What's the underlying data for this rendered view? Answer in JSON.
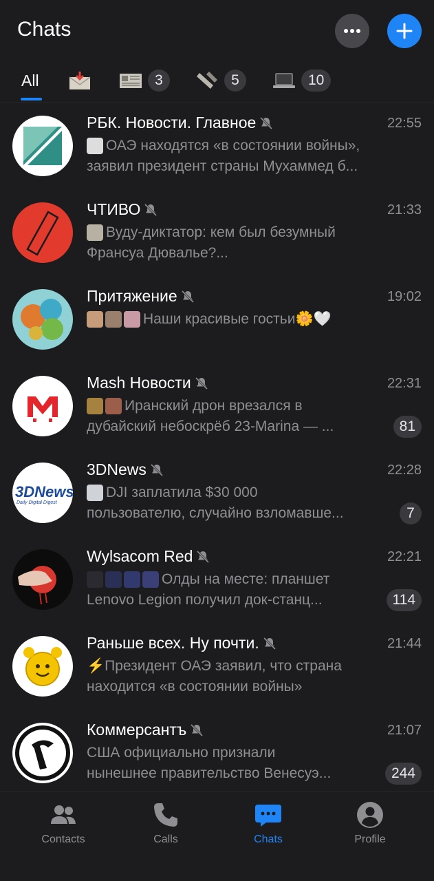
{
  "header": {
    "title": "Chats",
    "more_icon": "ellipsis-icon",
    "new_icon": "plus-icon"
  },
  "folders": [
    {
      "label": "All",
      "active": true
    },
    {
      "icon": "inbox-icon",
      "count": ""
    },
    {
      "icon": "newspaper-icon",
      "count": "3"
    },
    {
      "icon": "scroll-icon",
      "count": "5"
    },
    {
      "icon": "laptop-icon",
      "count": "10"
    }
  ],
  "chats": [
    {
      "name": "РБК. Новости. Главное",
      "time": "22:55",
      "line1": "ОАЭ находятся «в состоянии войны»,",
      "line2": "заявил президент страны Мухаммед б...",
      "unread": ""
    },
    {
      "name": "ЧТИВО",
      "time": "21:33",
      "line1": "Вуду-диктатор: кем был безумный",
      "line2": "Франсуа Дювалье?...",
      "unread": ""
    },
    {
      "name": "Притяжение",
      "time": "19:02",
      "line1": "Наши красивые гостьи🌼🤍",
      "line2": "",
      "unread": ""
    },
    {
      "name": "Mash Новости",
      "time": "22:31",
      "line1": "Иранский дрон врезался в",
      "line2": "дубайский небоскрёб 23-Marina — ...",
      "unread": "81"
    },
    {
      "name": "3DNews",
      "time": "22:28",
      "line1": "DJI заплатила $30 000",
      "line2": "пользователю, случайно взломавше...",
      "unread": "7"
    },
    {
      "name": "Wylsacom Red",
      "time": "22:21",
      "line1": "Олды на месте: планшет",
      "line2": "Lenovo Legion получил док-станц...",
      "unread": "114"
    },
    {
      "name": "Раньше всех. Ну почти.",
      "time": "21:44",
      "line1": "⚡Президент ОАЭ заявил, что страна",
      "line2": "находится «в состоянии войны»",
      "unread": ""
    },
    {
      "name": "Коммерсантъ",
      "time": "21:07",
      "line1": "США официально признали",
      "line2": "нынешнее правительство Венесуэ...",
      "unread": "244"
    }
  ],
  "tabbar": [
    {
      "label": "Contacts",
      "icon": "contacts-icon"
    },
    {
      "label": "Calls",
      "icon": "phone-icon"
    },
    {
      "label": "Chats",
      "icon": "chat-bubble-icon",
      "active": true
    },
    {
      "label": "Profile",
      "icon": "profile-icon"
    }
  ],
  "avatars": {
    "rbk_logo_text": "",
    "threed_logo": "3DNews",
    "threed_sub": "Daily Digital Digest"
  }
}
